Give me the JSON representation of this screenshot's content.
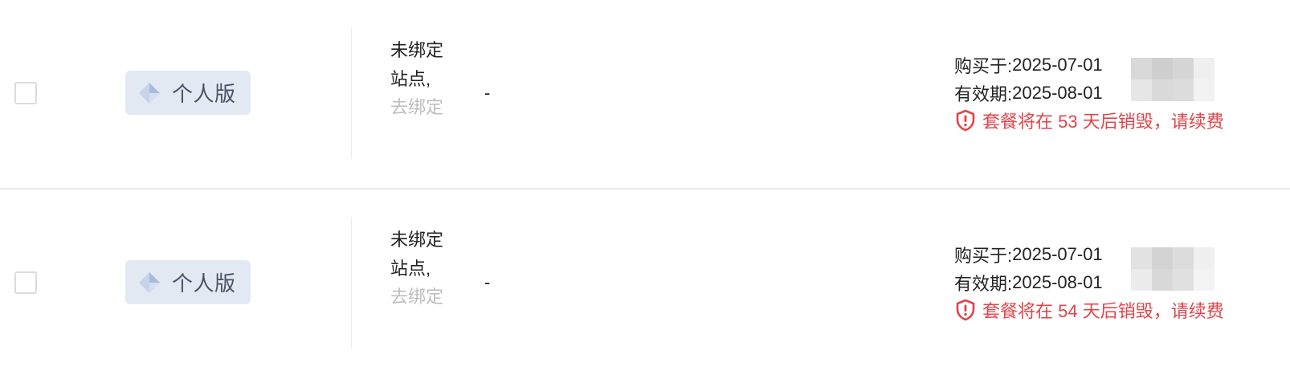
{
  "rows": [
    {
      "edition_label": "个人版",
      "site_status": "未绑定站点,",
      "site_action": "去绑定",
      "extra_value": "-",
      "purchase_label": "购买于:",
      "purchase_date": "2025-07-01",
      "expiry_label": "有效期:",
      "expiry_date": "2025-08-01",
      "warning_text": "套餐将在 53 天后销毁，请续费"
    },
    {
      "edition_label": "个人版",
      "site_status": "未绑定站点,",
      "site_action": "去绑定",
      "extra_value": "-",
      "purchase_label": "购买于:",
      "purchase_date": "2025-07-01",
      "expiry_label": "有效期:",
      "expiry_date": "2025-08-01",
      "warning_text": "套餐将在 54 天后销毁，请续费"
    }
  ],
  "colors": {
    "badge_bg": "#e3e9f3",
    "badge_text": "#4a5266",
    "warning": "#e0454b",
    "link_muted": "#bdbdbd",
    "divider": "#e9e9e9"
  },
  "icons": {
    "edition": "diamond-icon",
    "warning": "shield-exclamation-icon"
  }
}
